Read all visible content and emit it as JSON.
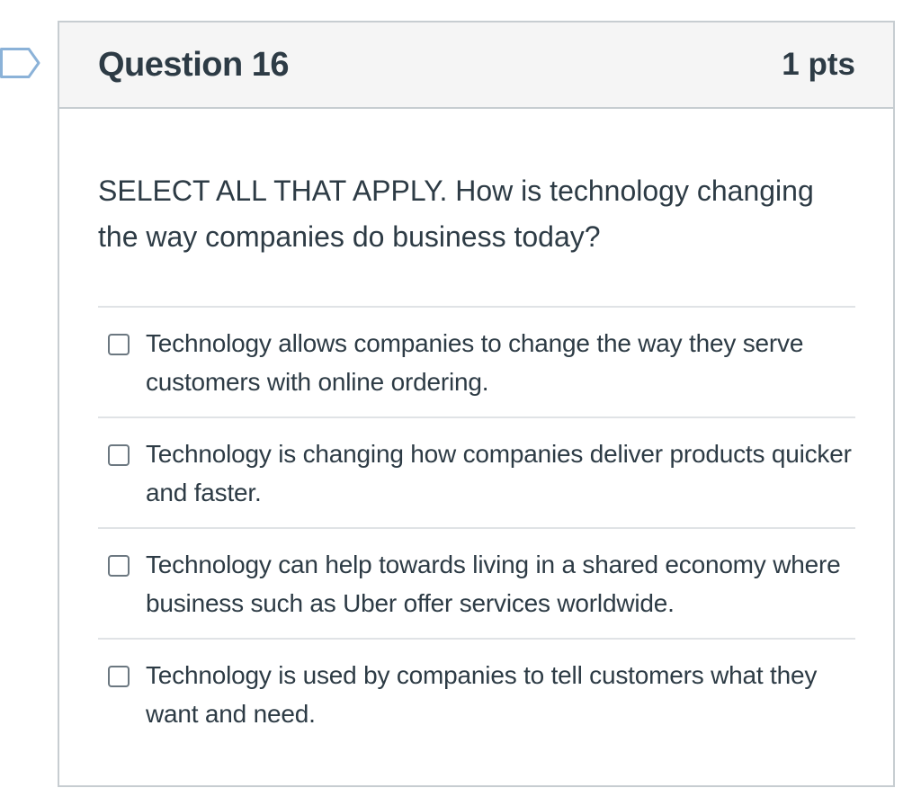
{
  "question": {
    "title": "Question 16",
    "points": "1 pts",
    "text": "SELECT ALL THAT APPLY. How is technology changing the way companies do business today?",
    "flag_icon": "bookmark-flag-icon",
    "answers": [
      {
        "label": "Technology allows companies to change the way they serve customers with online ordering.",
        "checked": false
      },
      {
        "label": "Technology is changing how companies deliver products quicker and faster.",
        "checked": false
      },
      {
        "label": "Technology can help towards living in a shared economy where business such as Uber offer services worldwide.",
        "checked": false
      },
      {
        "label": "Technology is used by companies to tell customers what they want and need.",
        "checked": false
      }
    ]
  },
  "colors": {
    "text": "#2d3b45",
    "header_bg": "#f5f5f5",
    "border": "#c7cdd1",
    "divider": "#e0e3e6",
    "flag_outline": "#8bb2d8"
  }
}
